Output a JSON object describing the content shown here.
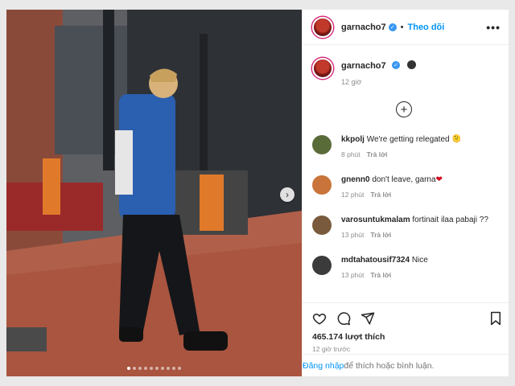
{
  "post": {
    "username": "garnacho7",
    "follow_label": "Theo dõi",
    "more_label": "•••",
    "caption_time": "12 giờ",
    "carousel": {
      "total_slides": 10,
      "active_slide": 1
    }
  },
  "comments": [
    {
      "username": "kkpolj",
      "text": "We're getting relegated 🫠",
      "time": "8 phút",
      "reply": "Trả lời",
      "color": "#5a6b3a"
    },
    {
      "username": "gnenn0",
      "text": "don't leave, garna",
      "emoji": "❤",
      "time": "12 phút",
      "reply": "Trả lời",
      "color": "#c9743a"
    },
    {
      "username": "varosuntukmalam",
      "text": "fortinait ilaa pabaji ??",
      "time": "13 phút",
      "reply": "Trả lời",
      "color": "#7a5a3c"
    },
    {
      "username": "mdtahatousif7324",
      "text": "Nice",
      "time": "13 phút",
      "reply": "Trả lời",
      "color": "#3b3b3b"
    }
  ],
  "engagement": {
    "likes": "465.174 lượt thích",
    "posted": "12 giờ trước"
  },
  "login_prompt": {
    "link": "Đăng nhập",
    "rest": " để thích hoặc bình luận."
  },
  "colors": {
    "accent": "#0095f6",
    "verified": "#3897f0"
  }
}
